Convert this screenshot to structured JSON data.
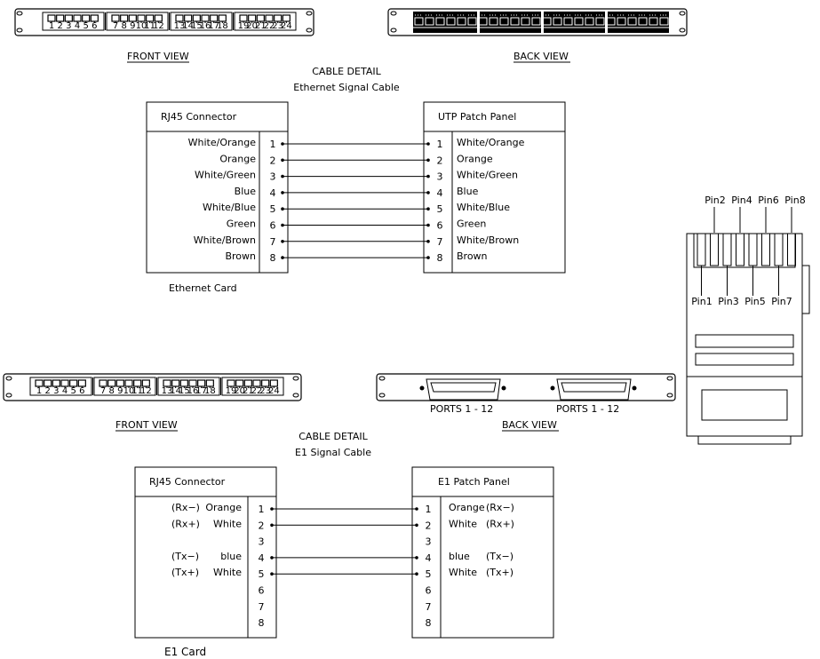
{
  "top_section": {
    "front_view_label": "FRONT VIEW",
    "back_view_label": "BACK VIEW",
    "port_numbers": [
      "1",
      "2",
      "3",
      "4",
      "5",
      "6",
      "7",
      "8",
      "9",
      "10",
      "11",
      "12",
      "13",
      "14",
      "15",
      "16",
      "17",
      "18",
      "19",
      "20",
      "21",
      "22",
      "23",
      "24"
    ],
    "cable_detail_title": "CABLE DETAIL",
    "cable_detail_subtitle": "Ethernet Signal Cable",
    "left_box": {
      "title": "RJ45 Connector",
      "caption": "Ethernet  Card",
      "rows": [
        {
          "pin": "1",
          "color": "White/Orange"
        },
        {
          "pin": "2",
          "color": "Orange"
        },
        {
          "pin": "3",
          "color": "White/Green"
        },
        {
          "pin": "4",
          "color": "Blue"
        },
        {
          "pin": "5",
          "color": "White/Blue"
        },
        {
          "pin": "6",
          "color": "Green"
        },
        {
          "pin": "7",
          "color": "White/Brown"
        },
        {
          "pin": "8",
          "color": "Brown"
        }
      ]
    },
    "right_box": {
      "title": "UTP Patch Panel",
      "rows": [
        {
          "pin": "1",
          "color": "White/Orange"
        },
        {
          "pin": "2",
          "color": "Orange"
        },
        {
          "pin": "3",
          "color": "White/Green"
        },
        {
          "pin": "4",
          "color": "Blue"
        },
        {
          "pin": "5",
          "color": "White/Blue"
        },
        {
          "pin": "6",
          "color": "Green"
        },
        {
          "pin": "7",
          "color": "White/Brown"
        },
        {
          "pin": "8",
          "color": "Brown"
        }
      ]
    }
  },
  "rj45_plug": {
    "top_pins": [
      "Pin2",
      "Pin4",
      "Pin6",
      "Pin8"
    ],
    "bottom_pins": [
      "Pin1",
      "Pin3",
      "Pin5",
      "Pin7"
    ]
  },
  "bottom_section": {
    "front_view_label": "FRONT VIEW",
    "back_view_label": "BACK VIEW",
    "back_ports_left": "PORTS 1 - 12",
    "back_ports_right": "PORTS 1 - 12",
    "cable_detail_title": "CABLE DETAIL",
    "cable_detail_subtitle": "E1 Signal Cable",
    "left_box": {
      "title": "RJ45 Connector",
      "caption": "E1  Card",
      "rows": [
        {
          "pin": "1",
          "signal": "(Rx−)",
          "color": "Orange"
        },
        {
          "pin": "2",
          "signal": "(Rx+)",
          "color": "White"
        },
        {
          "pin": "3",
          "signal": "",
          "color": ""
        },
        {
          "pin": "4",
          "signal": "(Tx−)",
          "color": "blue"
        },
        {
          "pin": "5",
          "signal": "(Tx+)",
          "color": "White"
        },
        {
          "pin": "6",
          "signal": "",
          "color": ""
        },
        {
          "pin": "7",
          "signal": "",
          "color": ""
        },
        {
          "pin": "8",
          "signal": "",
          "color": ""
        }
      ]
    },
    "right_box": {
      "title": "E1 Patch Panel",
      "rows": [
        {
          "pin": "1",
          "color": "Orange",
          "signal": "(Rx−)"
        },
        {
          "pin": "2",
          "color": "White",
          "signal": "(Rx+)"
        },
        {
          "pin": "3",
          "color": "",
          "signal": ""
        },
        {
          "pin": "4",
          "color": "blue",
          "signal": "(Tx−)"
        },
        {
          "pin": "5",
          "color": "White",
          "signal": "(Tx+)"
        },
        {
          "pin": "6",
          "color": "",
          "signal": ""
        },
        {
          "pin": "7",
          "color": "",
          "signal": ""
        },
        {
          "pin": "8",
          "color": "",
          "signal": ""
        }
      ]
    },
    "connected_pins": [
      "1",
      "2",
      "4",
      "5"
    ]
  }
}
